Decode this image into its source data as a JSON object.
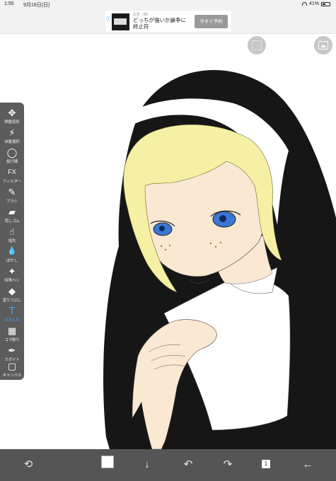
{
  "status_bar": {
    "time": "1:55",
    "date": "9月19日(日)",
    "battery": "41%",
    "wifi_icon": "wifi-icon",
    "battery_icon": "battery-icon"
  },
  "ad": {
    "info_icon": "ⓘ✕",
    "source": "広告（株）",
    "title": "どっちが強いか論争に終止符",
    "button": "今すぐ予約"
  },
  "top_buttons": {
    "grid_icon": "grid-icon",
    "gallery_icon": "gallery-icon"
  },
  "tools": [
    {
      "id": "move",
      "label": "移動変形",
      "glyph": "✥",
      "icon": "move-icon"
    },
    {
      "id": "magic",
      "label": "自動選択",
      "glyph": "⚡",
      "icon": "magic-wand-icon"
    },
    {
      "id": "lasso",
      "label": "投げ縄",
      "glyph": "◯",
      "icon": "lasso-icon"
    },
    {
      "id": "fx",
      "label": "フィルター",
      "glyph": "FX",
      "icon": "filter-icon"
    },
    {
      "id": "brush",
      "label": "ブラシ",
      "glyph": "✎",
      "icon": "brush-icon"
    },
    {
      "id": "eraser",
      "label": "消しゴム",
      "glyph": "▰",
      "icon": "eraser-icon"
    },
    {
      "id": "finger",
      "label": "指先",
      "glyph": "☝",
      "icon": "finger-icon"
    },
    {
      "id": "blur",
      "label": "ぼかし",
      "glyph": "💧",
      "icon": "blur-icon"
    },
    {
      "id": "special",
      "label": "特殊ペン",
      "glyph": "✦",
      "icon": "special-pen-icon"
    },
    {
      "id": "fill",
      "label": "塗りつぶし",
      "glyph": "◆",
      "icon": "fill-icon"
    },
    {
      "id": "text",
      "label": "文字入れ",
      "glyph": "T",
      "icon": "text-icon",
      "active": true
    },
    {
      "id": "frame",
      "label": "コマ割り",
      "glyph": "▦",
      "icon": "frame-divider-icon"
    },
    {
      "id": "dropper",
      "label": "スポイト",
      "glyph": "✒",
      "icon": "eyedropper-icon"
    },
    {
      "id": "canvas",
      "label": "キャンバス",
      "glyph": "▢",
      "icon": "canvas-icon"
    }
  ],
  "bottom_bar": {
    "rotate_glyph": "⟲",
    "down_glyph": "↓",
    "undo_glyph": "↶",
    "redo_glyph": "↷",
    "layer_count": "1",
    "back_glyph": "←",
    "current_color": "#ffffff"
  },
  "colors": {
    "toolbar_bg": "#5c5c5c",
    "active_tool": "#4ea3ff",
    "bottom_bar_bg": "#555555"
  }
}
